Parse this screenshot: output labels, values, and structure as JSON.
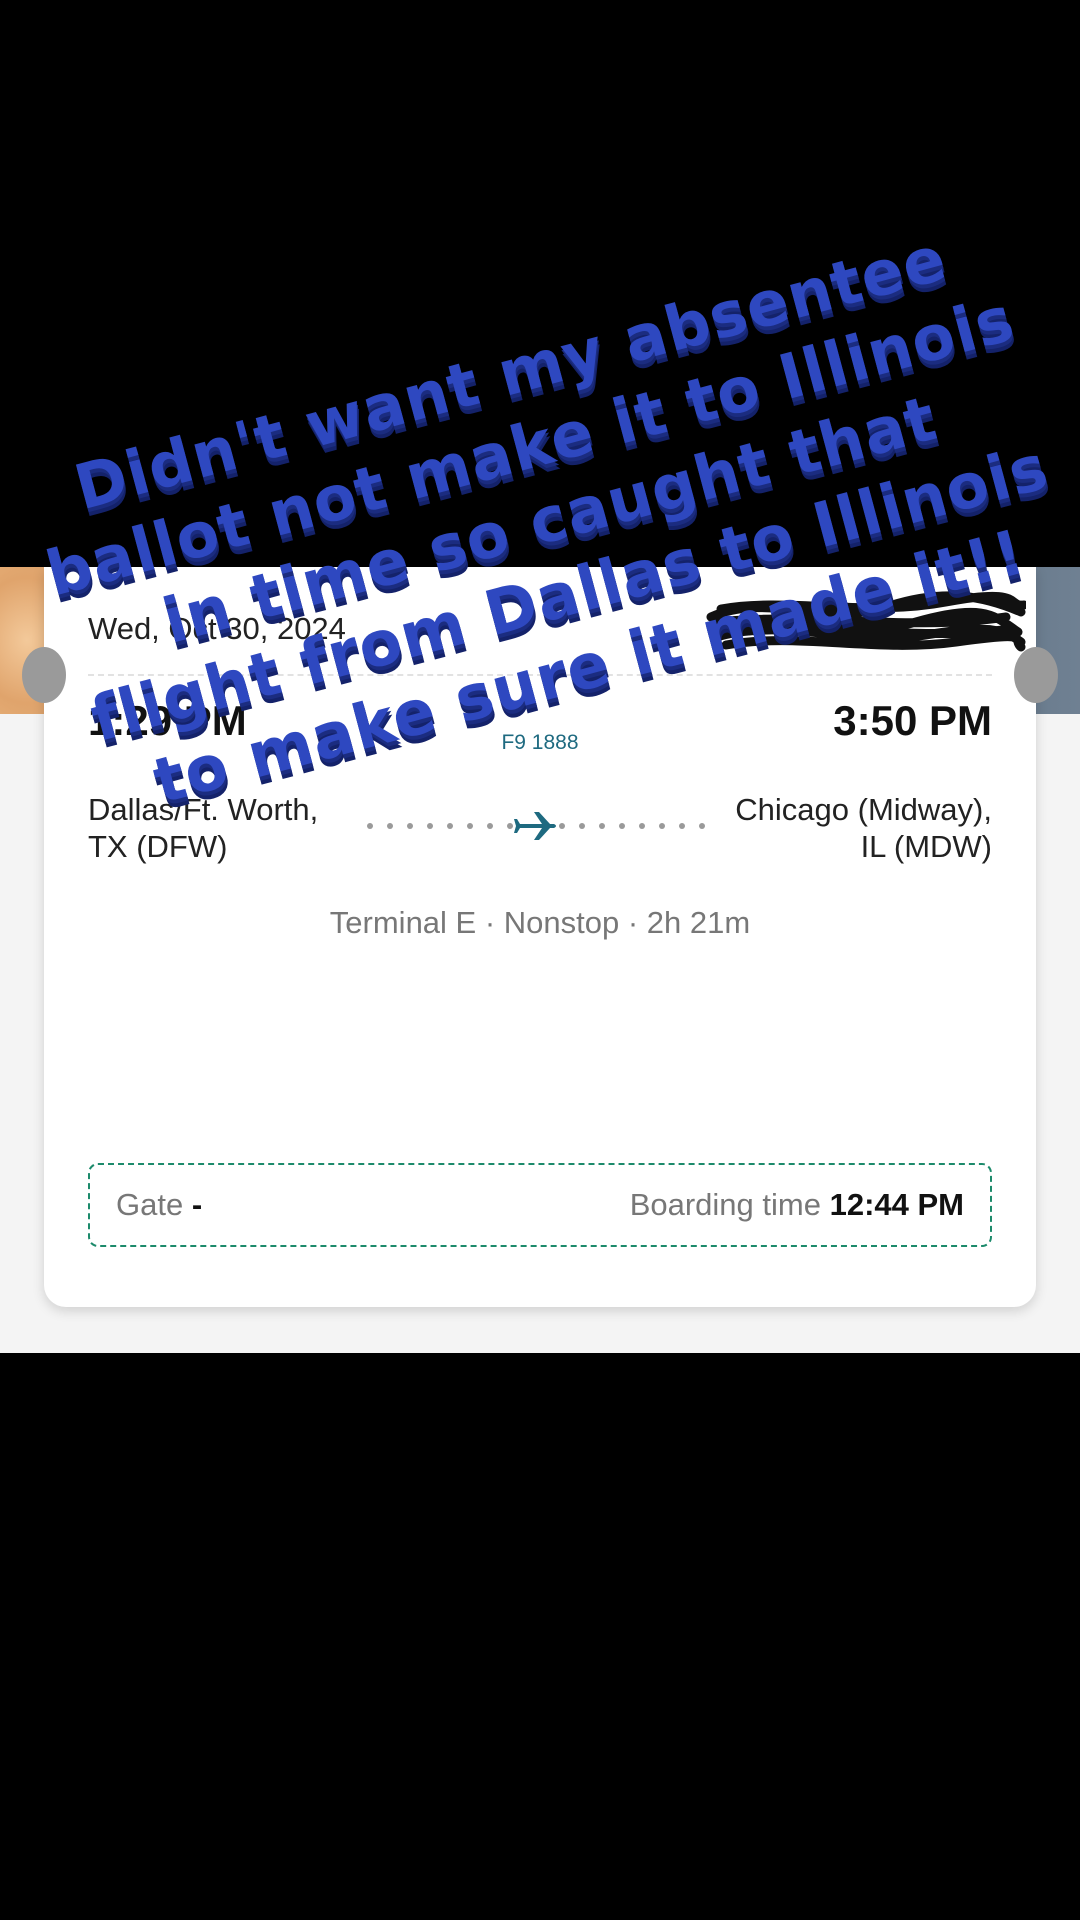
{
  "caption": {
    "line1": "Didn't want my absentee",
    "line2": "ballot not make it to Illinois",
    "line3": "in time so caught that",
    "line4": "flight from Dallas to Illinois",
    "line5": "to make sure it made it!!"
  },
  "ticket": {
    "date": "Wed, Oct 30, 2024",
    "departure": {
      "time": "1:29 PM",
      "city_line1": "Dallas/Ft. Worth,",
      "city_line2": "TX (DFW)"
    },
    "arrival": {
      "time": "3:50 PM",
      "city_line1": "Chicago (Midway),",
      "city_line2": "IL (MDW)"
    },
    "flight_number": "F9 1888",
    "details": "Terminal E · Nonstop · 2h 21m",
    "gate_label": "Gate",
    "gate_value": "-",
    "boarding_label": "Boarding time",
    "boarding_value": "12:44 PM",
    "plane_icon": "airplane-icon",
    "accent_color": "#1e6a80",
    "dash_color": "#1c8a6b"
  }
}
